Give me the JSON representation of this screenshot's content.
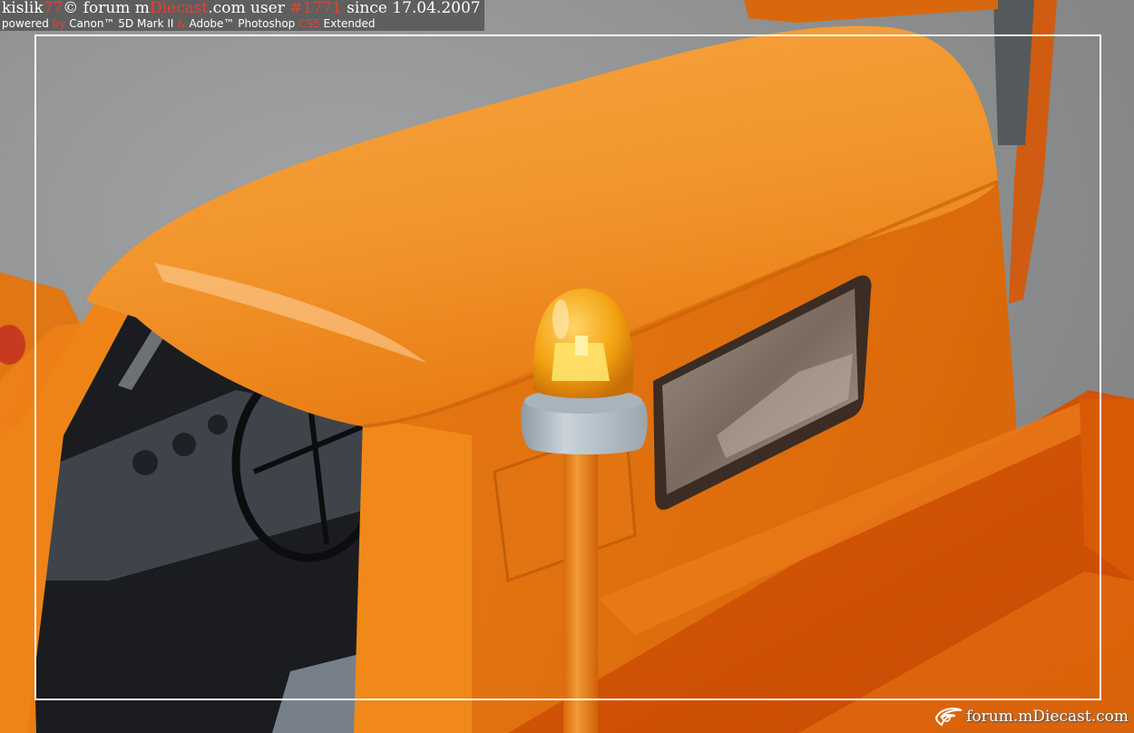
{
  "watermark_top": {
    "line1": [
      {
        "text": "kislik",
        "color": "#ffffff"
      },
      {
        "text": "77",
        "color": "#e8402a"
      },
      {
        "text": "© forum m",
        "color": "#ffffff"
      },
      {
        "text": "Diecast",
        "color": "#e8402a"
      },
      {
        "text": ".com user ",
        "color": "#ffffff"
      },
      {
        "text": "#1771",
        "color": "#e8402a"
      },
      {
        "text": " since 17.04.2007",
        "color": "#ffffff"
      }
    ],
    "line2": [
      {
        "text": "powered ",
        "color": "#ffffff"
      },
      {
        "text": "by ",
        "color": "#e8402a"
      },
      {
        "text": "Canon™ 5D Mark II ",
        "color": "#ffffff"
      },
      {
        "text": "& ",
        "color": "#e8402a"
      },
      {
        "text": "Adobe™ Photoshop ",
        "color": "#ffffff"
      },
      {
        "text": "CS5",
        "color": "#e8402a"
      },
      {
        "text": " Extended",
        "color": "#ffffff"
      }
    ]
  },
  "watermark_bottom": {
    "text": "forum.mDiecast.com",
    "logo_icon": "swoosh-logo-icon"
  },
  "colors": {
    "truck_body": "#f08a1e",
    "beacon_lens": "#f5a818",
    "beacon_base": "#b9c3cb",
    "background": "#8d8f90"
  }
}
